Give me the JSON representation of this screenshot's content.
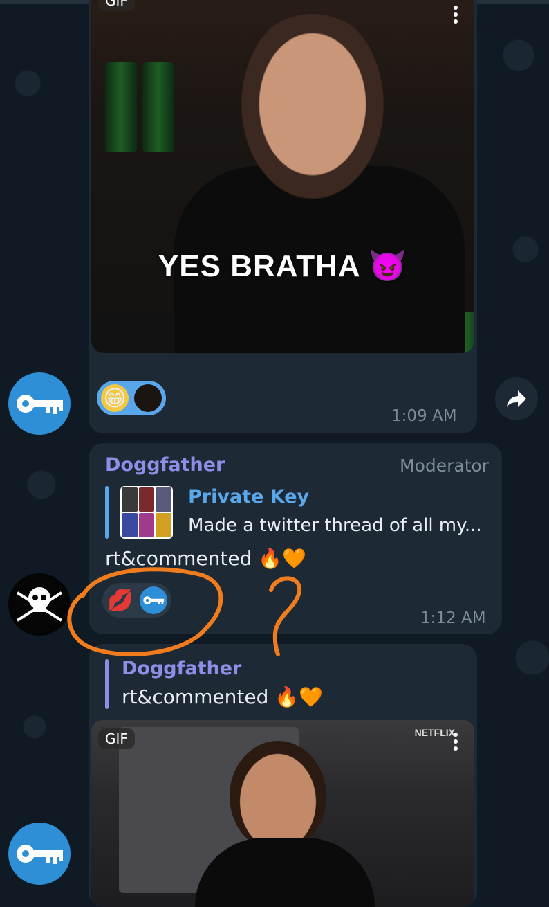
{
  "messages": [
    {
      "type": "gif",
      "badge": "GIF",
      "caption": "YES BRATHA",
      "caption_emoji": "😈",
      "reactions": [
        "😁",
        "🌑"
      ],
      "time": "1:09 AM"
    },
    {
      "sender": "Doggfather",
      "role": "Moderator",
      "reply": {
        "title": "Private Key",
        "text": "Made a twitter thread of all my..."
      },
      "text": "rt&commented 🔥🧡",
      "reactions": [
        "💋",
        "🔑"
      ],
      "time": "1:12 AM"
    },
    {
      "type": "gif",
      "reply": {
        "title": "Doggfather",
        "text": "rt&commented 🔥🧡"
      },
      "badge": "GIF",
      "watermark": "NETFLIX"
    }
  ],
  "annotation": {
    "question_mark": "?"
  },
  "colors": {
    "background": "#0f1a24",
    "bubble": "#1d2935",
    "accent_purple": "#8e8ee6",
    "accent_blue": "#5aa6ea",
    "annotation_orange": "#f07c1e",
    "avatar_blue": "#2f8fd6"
  },
  "icons": [
    "key-icon",
    "skull-crossbones-icon",
    "forward-arrow-icon",
    "more-vertical-icon"
  ]
}
